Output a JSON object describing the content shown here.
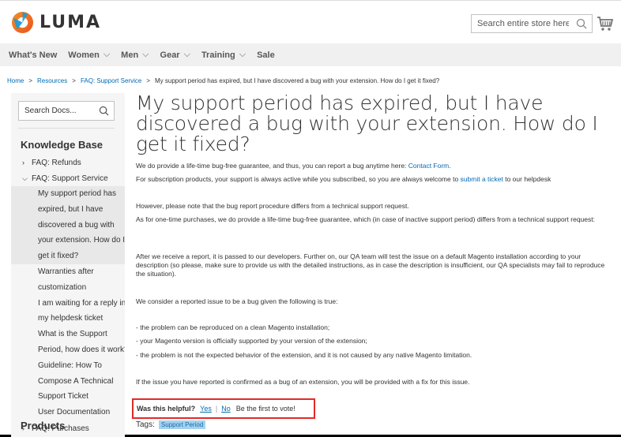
{
  "header": {
    "logo_text": "LUMA",
    "search_placeholder": "Search entire store here..."
  },
  "nav": {
    "items": [
      {
        "label": "What's New",
        "has_chevron": false
      },
      {
        "label": "Women",
        "has_chevron": true
      },
      {
        "label": "Men",
        "has_chevron": true
      },
      {
        "label": "Gear",
        "has_chevron": true
      },
      {
        "label": "Training",
        "has_chevron": true
      },
      {
        "label": "Sale",
        "has_chevron": false
      }
    ],
    "chevron": "⌵"
  },
  "breadcrumb": {
    "items": [
      "Home",
      "Resources",
      "FAQ: Support Service"
    ],
    "current": "My support period has expired, but I have discovered a bug with your extension. How do I get it fixed?",
    "separator": ">"
  },
  "sidebar": {
    "search_placeholder": "Search Docs...",
    "kb_title": "Knowledge Base",
    "refunds": "FAQ: Refunds",
    "support_service": "FAQ: Support Service",
    "sub_items": [
      "My support period has",
      "expired, but I have",
      "discovered a bug with",
      "your extension. How do I",
      "get it fixed?",
      "Warranties after",
      "customization",
      "I am waiting for a reply in",
      "my helpdesk ticket",
      "What is the Support",
      "Period, how does it work?",
      "Guideline: How To",
      "Compose A Technical",
      "Support Ticket",
      "User Documentation"
    ],
    "purchases": "FAQ: Purchases",
    "products_title": "Products",
    "arrow_right": "›",
    "arrow_down": "⌵"
  },
  "article": {
    "title": "My support period has expired, but I have discovered a bug with your extension. How do I get it fixed?",
    "p1_text": "We do provide a life-time bug-free guarantee, and thus, you can report a bug anytime here: ",
    "p1_link": "Contact Form",
    "p1_end": ".",
    "p2_text": "For subscription products, your support is always active while you subscribed, so you are always welcome to ",
    "p2_link": "submit a ticket",
    "p2_end": " to our helpdesk",
    "p3": "However, please note that the bug report procedure differs from a technical support request.",
    "p4": "As for one-time purchases, we do provide a life-time bug-free guarantee, which (in case of inactive support period) differs from a technical support request:",
    "p5": "After we receive a report, it is passed to our developers. Further on, our QA team will test the issue on a default Magento installation according to your description (so please, make sure to provide us with the detailed instructions, as in case the description is insufficient, our QA specialists may fail to reproduce the situation).",
    "p6": "We consider a reported issue to be a bug given the following is true:",
    "bullets": [
      "- the problem can be reproduced on a clean Magento installation;",
      "- your Magento version is officially supported by your version of the extension;",
      "- the problem is not the expected behavior of the extension, and it is not caused by any native Magento limitation."
    ],
    "p7": "If the issue you have reported is confirmed as a bug of an extension, you will be provided with a fix for this issue."
  },
  "feedback": {
    "question": "Was this helpful?",
    "yes": "Yes",
    "separator": "|",
    "no": "No",
    "first_vote": "Be the first to vote!"
  },
  "tags": {
    "label": "Tags:",
    "items": [
      "Support Period"
    ]
  },
  "colors": {
    "link": "#006bb4",
    "logo_orange": "#f26322",
    "highlight_border": "#e02b27",
    "tag_bg": "#a3d3f0"
  }
}
